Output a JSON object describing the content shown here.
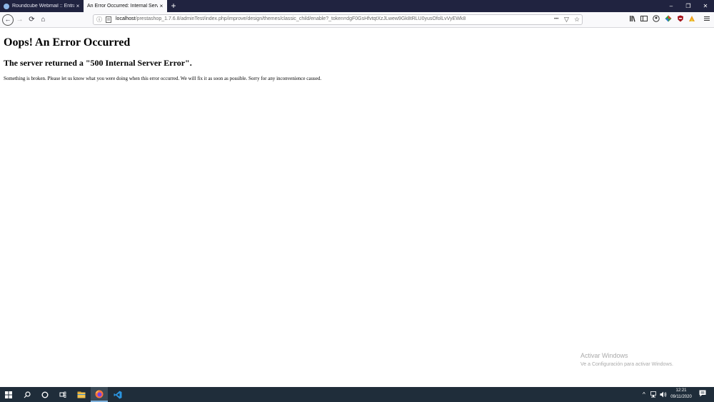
{
  "browser": {
    "tabs": [
      {
        "title": "Roundcube Webmail :: Entrada",
        "close_icon": "×"
      },
      {
        "title": "An Error Occurred: Internal Server E",
        "close_icon": "×"
      }
    ],
    "new_tab_icon": "+",
    "window_controls": {
      "minimize": "–",
      "restore": "❐",
      "close": "✕"
    },
    "nav": {
      "back": "←",
      "forward": "→",
      "reload": "⟳",
      "home": "⌂"
    },
    "url": {
      "host": "localhost",
      "path": "/prestashop_1.7.6.8/adminTest/index.php/improve/design/themes/classic_child/enable?_token=dgF0GsHfvtqtXzJLwew9Gk8tRLU0yusOfolLvVyEWk8"
    },
    "url_actions": {
      "more": "•••",
      "pocket": "▽",
      "bookmark": "☆"
    },
    "toolbar_icons": [
      "library-icon",
      "sidebar-icon",
      "account-icon",
      "extension-icon",
      "ublock-icon",
      "addon-icon",
      "menu-icon"
    ]
  },
  "page": {
    "heading": "Oops! An Error Occurred",
    "subheading": "The server returned a \"500 Internal Server Error\".",
    "message": "Something is broken. Please let us know what you were doing when this error occurred. We will fix it as soon as possible. Sorry for any inconvenience caused."
  },
  "watermark": {
    "title": "Activar Windows",
    "subtitle": "Ve a Configuración para activar Windows."
  },
  "taskbar": {
    "clock_time": "12:21",
    "clock_date": "09/11/2020"
  },
  "colors": {
    "tab_bar": "#202340",
    "taskbar": "#1f2d3a",
    "active_tab": "#f9f9fb"
  }
}
